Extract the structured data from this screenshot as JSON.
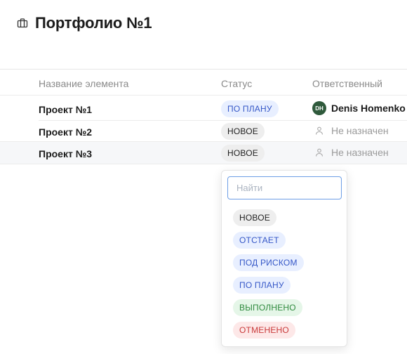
{
  "header": {
    "title": "Портфолио №1",
    "icon": "briefcase-icon"
  },
  "table": {
    "columns": [
      "Название элемента",
      "Статус",
      "Ответственный"
    ],
    "rows": [
      {
        "name": "Проект №1",
        "status": "ПО ПЛАНУ",
        "owner": "Denis Homenko",
        "owner_initials": "DH"
      },
      {
        "name": "Проект №2",
        "status": "НОВОЕ",
        "owner": "Не назначен"
      },
      {
        "name": "Проект №3",
        "status": "НОВОЕ",
        "owner": "Не назначен"
      }
    ]
  },
  "dropdown": {
    "search_placeholder": "Найти",
    "options": [
      "НОВОЕ",
      "ОТСТАЕТ",
      "ПОД РИСКОМ",
      "ПО ПЛАНУ",
      "ВЫПОЛНЕНО",
      "ОТМЕНЕНО"
    ]
  },
  "colors": {
    "plan": "#3557c7",
    "done": "#2f8a3e",
    "cancel": "#c93a3a",
    "avatar": "#2f5a3c",
    "focus_border": "#6d9ee6"
  }
}
